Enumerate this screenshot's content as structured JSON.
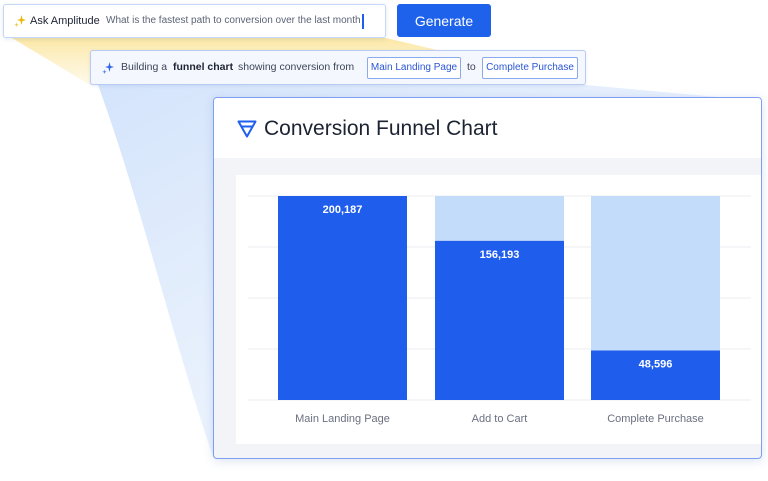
{
  "ask": {
    "label": "Ask Amplitude",
    "query": "What is the fastest path to conversion over the  last month"
  },
  "generate_label": "Generate",
  "status": {
    "prefix": "Building a",
    "chart_kind": "funnel chart",
    "middle": "showing conversion from",
    "from_step": "Main Landing Page",
    "connector": "to",
    "to_step": "Complete Purchase"
  },
  "card": {
    "title": "Conversion Funnel Chart"
  },
  "colors": {
    "accent": "#1e62ec",
    "bar": "#1f5ded",
    "bar_remaining": "#c2dcfa",
    "beam": "#fbe9a6"
  },
  "chart_data": {
    "type": "bar",
    "title": "Conversion Funnel Chart",
    "categories": [
      "Main Landing Page",
      "Add to Cart",
      "Complete Purchase"
    ],
    "series": [
      {
        "values": [
          200187,
          156193,
          48596
        ]
      }
    ],
    "value_labels": [
      "200,187",
      "156,193",
      "48,596"
    ],
    "ylim": [
      0,
      200187
    ],
    "grid": true,
    "legend": "none"
  }
}
